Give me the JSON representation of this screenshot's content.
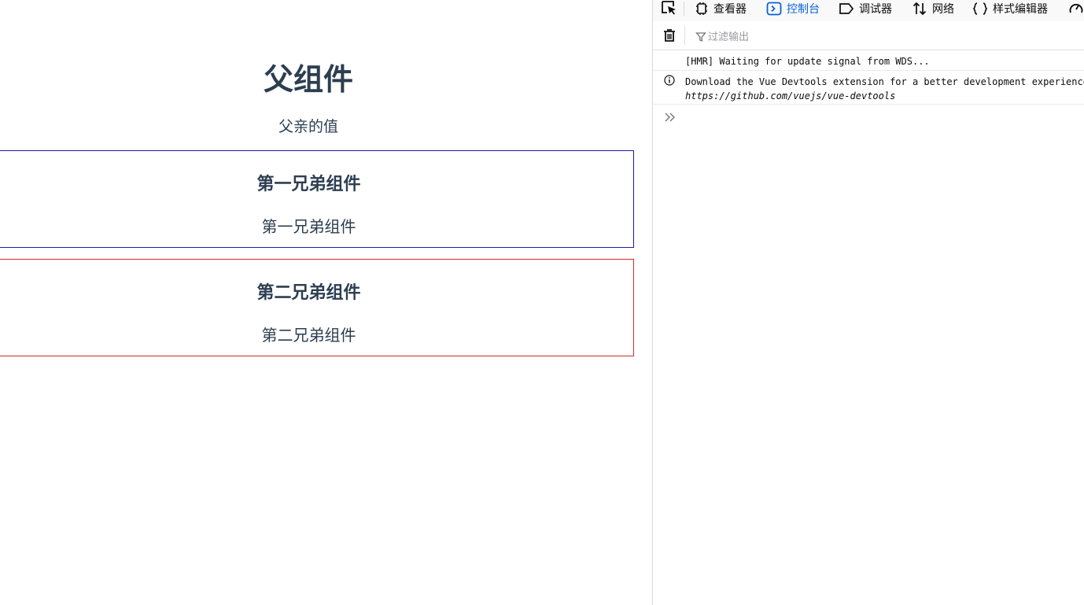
{
  "app": {
    "parent_title": "父组件",
    "parent_value": "父亲的值",
    "siblings": [
      {
        "title": "第一兄弟组件",
        "text": "第一兄弟组件",
        "border_color": "#1a1aa8"
      },
      {
        "title": "第二兄弟组件",
        "text": "第二兄弟组件",
        "border_color": "#d42a2a"
      }
    ]
  },
  "devtools": {
    "tabs": [
      {
        "label": "查看器",
        "icon": "inspector-icon"
      },
      {
        "label": "控制台",
        "icon": "console-icon",
        "active": true
      },
      {
        "label": "调试器",
        "icon": "debugger-icon"
      },
      {
        "label": "网络",
        "icon": "network-icon"
      },
      {
        "label": "样式编辑器",
        "icon": "style-editor-icon"
      }
    ],
    "filter_placeholder": "过滤输出",
    "messages": [
      {
        "text": "[HMR] Waiting for update signal from WDS..."
      },
      {
        "text": "Download the Vue Devtools extension for a better development experience:",
        "link": "https://github.com/vuejs/vue-devtools",
        "icon": "info-icon"
      }
    ],
    "accent_color": "#0a62d6"
  }
}
